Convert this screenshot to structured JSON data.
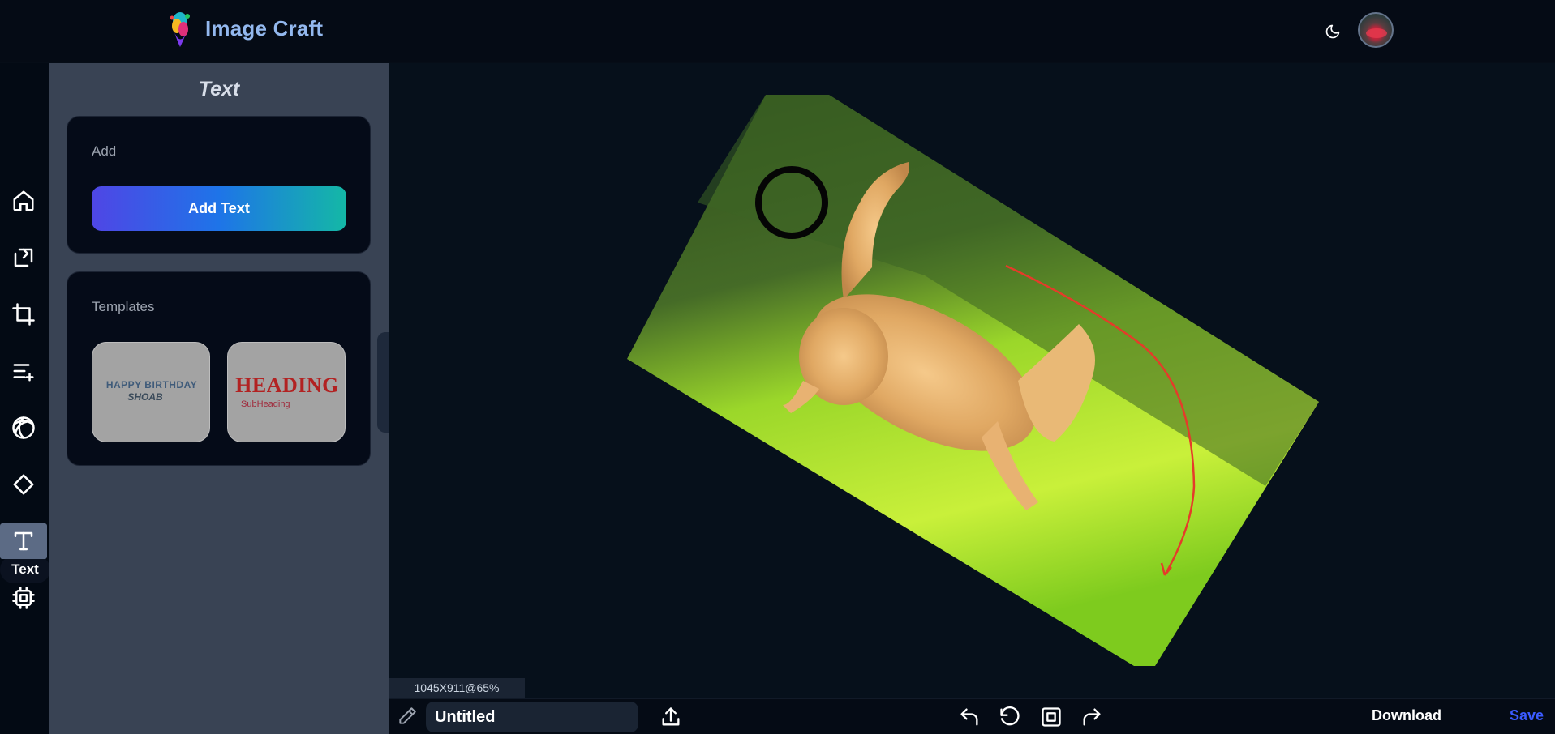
{
  "app": {
    "name": "Image Craft",
    "logo_icon": "paint-splash-logo"
  },
  "header": {
    "theme_toggle_icon": "moon-icon",
    "avatar_alt": "user-avatar"
  },
  "rail": {
    "items": [
      {
        "name": "home",
        "icon": "home-icon"
      },
      {
        "name": "rotate",
        "icon": "rotate-icon"
      },
      {
        "name": "crop",
        "icon": "crop-icon"
      },
      {
        "name": "adjust",
        "icon": "list-plus-icon"
      },
      {
        "name": "filters",
        "icon": "aperture-icon"
      },
      {
        "name": "shapes",
        "icon": "diamond-icon"
      },
      {
        "name": "text",
        "icon": "text-icon",
        "active": true
      },
      {
        "name": "ai",
        "icon": "chip-icon"
      }
    ],
    "tooltip": "Text"
  },
  "panel": {
    "title": "Text",
    "add_section": {
      "label": "Add",
      "button": "Add Text"
    },
    "templates_section": {
      "label": "Templates",
      "items": [
        {
          "line1": "HAPPY BIRTHDAY",
          "line2": "SHOAB"
        },
        {
          "line1": "HEADING",
          "line2": "SubHeading"
        }
      ]
    }
  },
  "canvas": {
    "status": "1045X911@65%"
  },
  "bottombar": {
    "title_value": "Untitled",
    "download": "Download",
    "save": "Save"
  },
  "colors": {
    "accent": "#3b5bff",
    "brand": "#93b8ee",
    "panel": "#394354",
    "gradient_start": "#4f46e5",
    "gradient_end": "#14b8a6"
  }
}
